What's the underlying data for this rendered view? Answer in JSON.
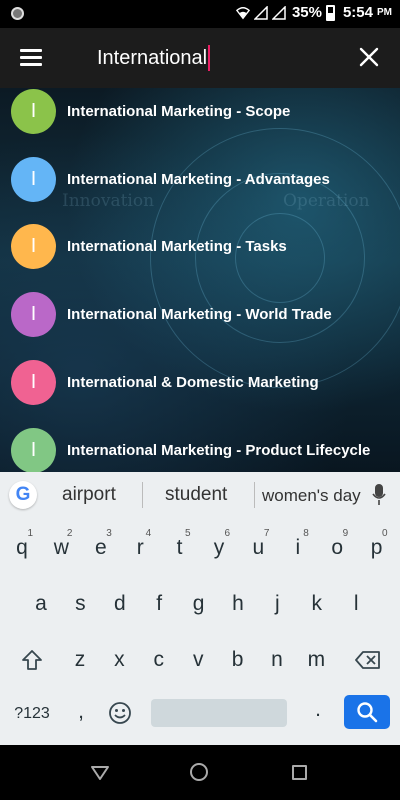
{
  "status_bar": {
    "battery_percent": "35%",
    "time": "5:54",
    "ampm": "PM"
  },
  "toolbar": {
    "search_value": "International"
  },
  "results": [
    {
      "initial": "I",
      "label": "International Marketing - Scope",
      "color": "#8bc34a"
    },
    {
      "initial": "I",
      "label": "International Marketing - Advantages",
      "color": "#64b5f6"
    },
    {
      "initial": "I",
      "label": "International Marketing - Tasks",
      "color": "#ffb74d"
    },
    {
      "initial": "I",
      "label": "International Marketing - World Trade",
      "color": "#ba68c8"
    },
    {
      "initial": "I",
      "label": "International & Domestic Marketing",
      "color": "#f06292"
    },
    {
      "initial": "I",
      "label": "International Marketing - Product Lifecycle",
      "color": "#81c784"
    }
  ],
  "background_words": [
    "Innovation",
    "Operation"
  ],
  "keyboard": {
    "google_logo": "G",
    "suggestions": [
      "airport",
      "student",
      "women's day"
    ],
    "row1": [
      "q",
      "w",
      "e",
      "r",
      "t",
      "y",
      "u",
      "i",
      "o",
      "p"
    ],
    "row1_hints": [
      "1",
      "2",
      "3",
      "4",
      "5",
      "6",
      "7",
      "8",
      "9",
      "0"
    ],
    "row2": [
      "a",
      "s",
      "d",
      "f",
      "g",
      "h",
      "j",
      "k",
      "l"
    ],
    "row3": [
      "z",
      "x",
      "c",
      "v",
      "b",
      "n",
      "m"
    ],
    "symbols_key": "?123",
    "comma_key": ",",
    "period_key": "."
  },
  "colors": {
    "accent_cursor": "#e91e63",
    "search_key": "#1a73e8",
    "toolbar": "#1c1c1c"
  }
}
